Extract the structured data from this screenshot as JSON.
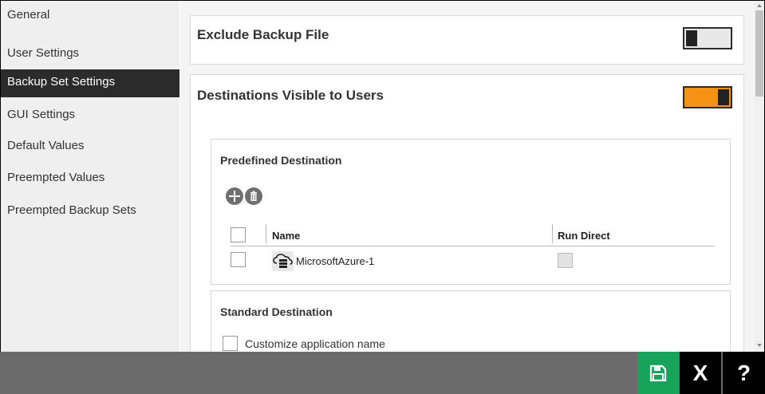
{
  "sidebar": {
    "items": [
      {
        "label": "General",
        "active": false
      },
      {
        "label": "User Settings",
        "active": false
      },
      {
        "label": "Backup Set Settings",
        "active": true
      },
      {
        "label": "GUI Settings",
        "active": false
      },
      {
        "label": "Default Values",
        "active": false
      },
      {
        "label": "Preempted Values",
        "active": false
      },
      {
        "label": "Preempted Backup Sets",
        "active": false
      }
    ]
  },
  "main": {
    "exclude_backup": {
      "title": "Exclude Backup File",
      "toggle": "off"
    },
    "destinations": {
      "title": "Destinations Visible to Users",
      "toggle": "on",
      "predefined": {
        "title": "Predefined Destination",
        "columns": [
          "Name",
          "Run Direct"
        ],
        "rows": [
          {
            "name": "MicrosoftAzure-1",
            "checked": false,
            "run_direct": false,
            "icon": "cloud-storage-icon"
          }
        ]
      },
      "standard": {
        "title": "Standard Destination",
        "customize_label": "Customize application name"
      }
    }
  },
  "footer": {
    "close_label": "X",
    "help_label": "?"
  },
  "colors": {
    "accent": "#f39214",
    "save": "#17a35a",
    "active_nav": "#2b2b2b",
    "footer": "#6b6b6b"
  }
}
